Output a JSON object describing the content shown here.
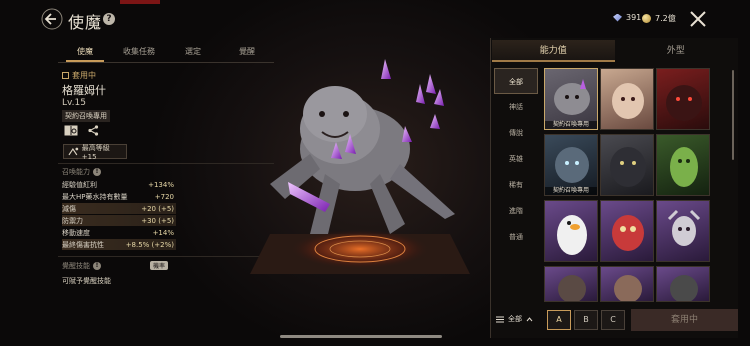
{
  "header": {
    "title": "使魔",
    "help": "?",
    "currency": {
      "diamond": "391",
      "gold": "7.2億"
    }
  },
  "tabs": [
    {
      "label": "使魔"
    },
    {
      "label": "收集任務"
    },
    {
      "label": "選定"
    },
    {
      "label": "覺醒"
    }
  ],
  "familiar": {
    "status": "套用中",
    "name": "格羅姆什",
    "level": "Lv.15",
    "contract_badge": "契約召喚專用",
    "max_level_label": "最高等級 +15"
  },
  "summon_ability": {
    "label": "召喚能力",
    "stats": [
      {
        "name": "經驗值紅利",
        "value": "+134%"
      },
      {
        "name": "最大HP藥水持有數量",
        "value": "+720"
      },
      {
        "name": "減傷",
        "value": "+20 (+5)"
      },
      {
        "name": "防禦力",
        "value": "+30 (+5)"
      },
      {
        "name": "移動速度",
        "value": "+14%"
      },
      {
        "name": "最終傷害抗性",
        "value": "+8.5% (+2%)"
      }
    ]
  },
  "awakening": {
    "label": "覺醒技能",
    "badge": "機率",
    "note": "可賦予覺醒技能"
  },
  "right_panel": {
    "tabs": [
      {
        "label": "能力值"
      },
      {
        "label": "外型"
      }
    ],
    "categories": [
      {
        "label": "全部"
      },
      {
        "label": "神話"
      },
      {
        "label": "傳說"
      },
      {
        "label": "英雄"
      },
      {
        "label": "稀有"
      },
      {
        "label": "進階"
      },
      {
        "label": "普通"
      }
    ],
    "cards": [
      {
        "label": "契約召喚專用"
      },
      {
        "label": ""
      },
      {
        "label": ""
      },
      {
        "label": "契約召喚專用"
      },
      {
        "label": ""
      },
      {
        "label": ""
      },
      {
        "label": ""
      },
      {
        "label": ""
      },
      {
        "label": ""
      },
      {
        "label": ""
      },
      {
        "label": ""
      },
      {
        "label": ""
      }
    ],
    "filter": "全部",
    "grade_buttons": [
      {
        "label": "A"
      },
      {
        "label": "B"
      },
      {
        "label": "C"
      }
    ],
    "apply_button": "套用中"
  }
}
